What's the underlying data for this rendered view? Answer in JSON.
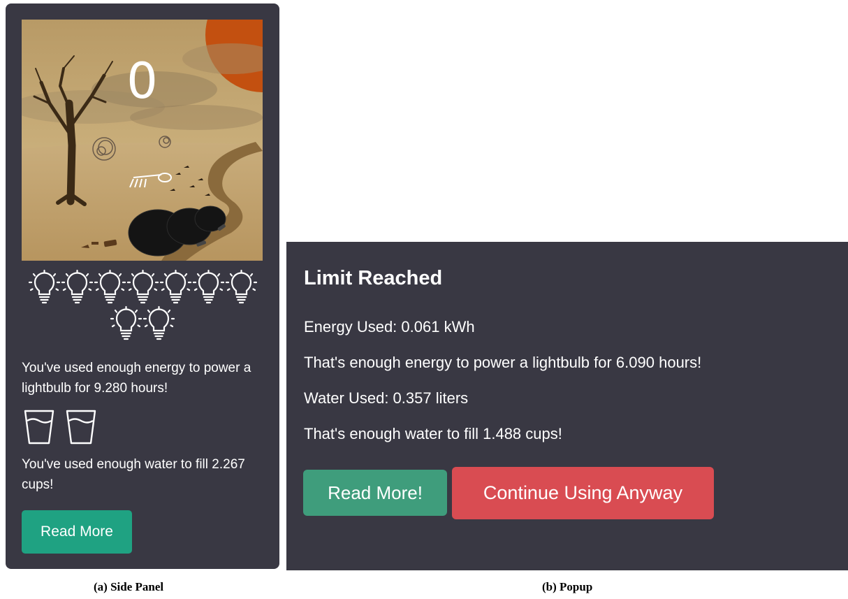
{
  "side_panel": {
    "score": "0",
    "lightbulb_count": 9,
    "cup_count": 2,
    "energy_text": "You've used enough energy to power a lightbulb for 9.280 hours!",
    "water_text": "You've used enough water to fill 2.267 cups!",
    "read_more_label": "Read More",
    "icons": {
      "bulb": "lightbulb-icon",
      "cup": "water-cup-icon"
    },
    "colors": {
      "panel": "#393843",
      "button": "#1fa282"
    }
  },
  "popup": {
    "title": "Limit Reached",
    "energy_used": "Energy Used: 0.061 kWh",
    "energy_equivalent": "That's enough energy to power a lightbulb for 6.090 hours!",
    "water_used": "Water Used: 0.357 liters",
    "water_equivalent": "That's enough water to fill 1.488 cups!",
    "read_more_label": "Read More!",
    "continue_label": "Continue Using Anyway",
    "colors": {
      "panel": "#393843",
      "read_more": "#3f9d7c",
      "continue": "#d94c52"
    }
  },
  "captions": {
    "a": "(a) Side Panel",
    "b": "(b) Popup"
  }
}
